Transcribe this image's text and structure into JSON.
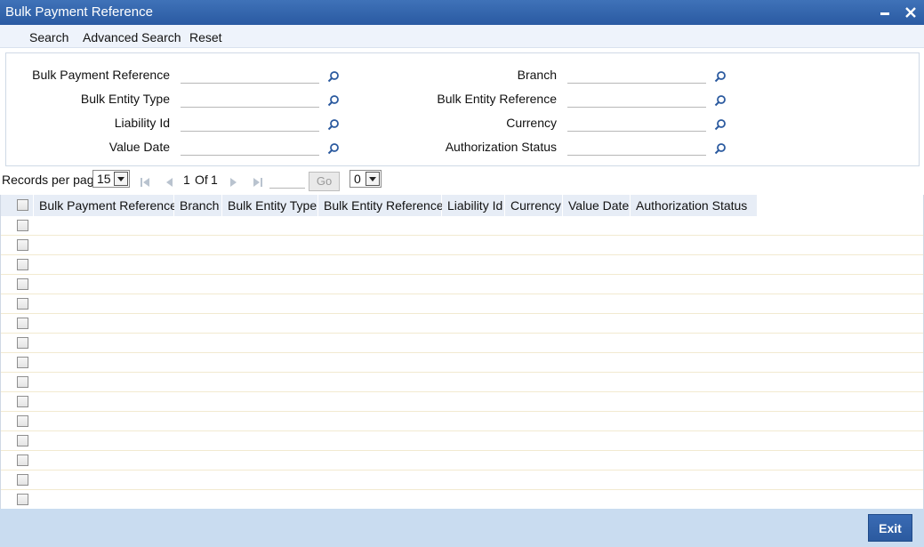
{
  "window": {
    "title": "Bulk Payment Reference"
  },
  "menu": {
    "search": "Search",
    "advanced_search": "Advanced Search",
    "reset": "Reset"
  },
  "criteria": {
    "bulk_payment_reference": {
      "label": "Bulk Payment Reference",
      "value": ""
    },
    "bulk_entity_type": {
      "label": "Bulk Entity Type",
      "value": ""
    },
    "liability_id": {
      "label": "Liability Id",
      "value": ""
    },
    "value_date": {
      "label": "Value Date",
      "value": ""
    },
    "branch": {
      "label": "Branch",
      "value": ""
    },
    "bulk_entity_reference": {
      "label": "Bulk Entity Reference",
      "value": ""
    },
    "currency": {
      "label": "Currency",
      "value": ""
    },
    "authorization_status": {
      "label": "Authorization Status",
      "value": ""
    }
  },
  "pager": {
    "records_per_page_label": "Records per page",
    "records_per_page": "15",
    "current_page": "1",
    "of_label": "Of",
    "total_pages": "1",
    "go_label": "Go",
    "page_select": "0"
  },
  "grid": {
    "columns": [
      "Bulk Payment Reference",
      "Branch",
      "Bulk Entity Type",
      "Bulk Entity Reference",
      "Liability Id",
      "Currency",
      "Value Date",
      "Authorization Status"
    ],
    "rows": [
      "",
      "",
      "",
      "",
      "",
      "",
      "",
      "",
      "",
      "",
      "",
      "",
      "",
      "",
      ""
    ]
  },
  "footer": {
    "exit_label": "Exit"
  },
  "colors": {
    "titlebar": "#2f62ab",
    "footer": "#c9dcf0",
    "header_cell": "#e7edf6"
  }
}
